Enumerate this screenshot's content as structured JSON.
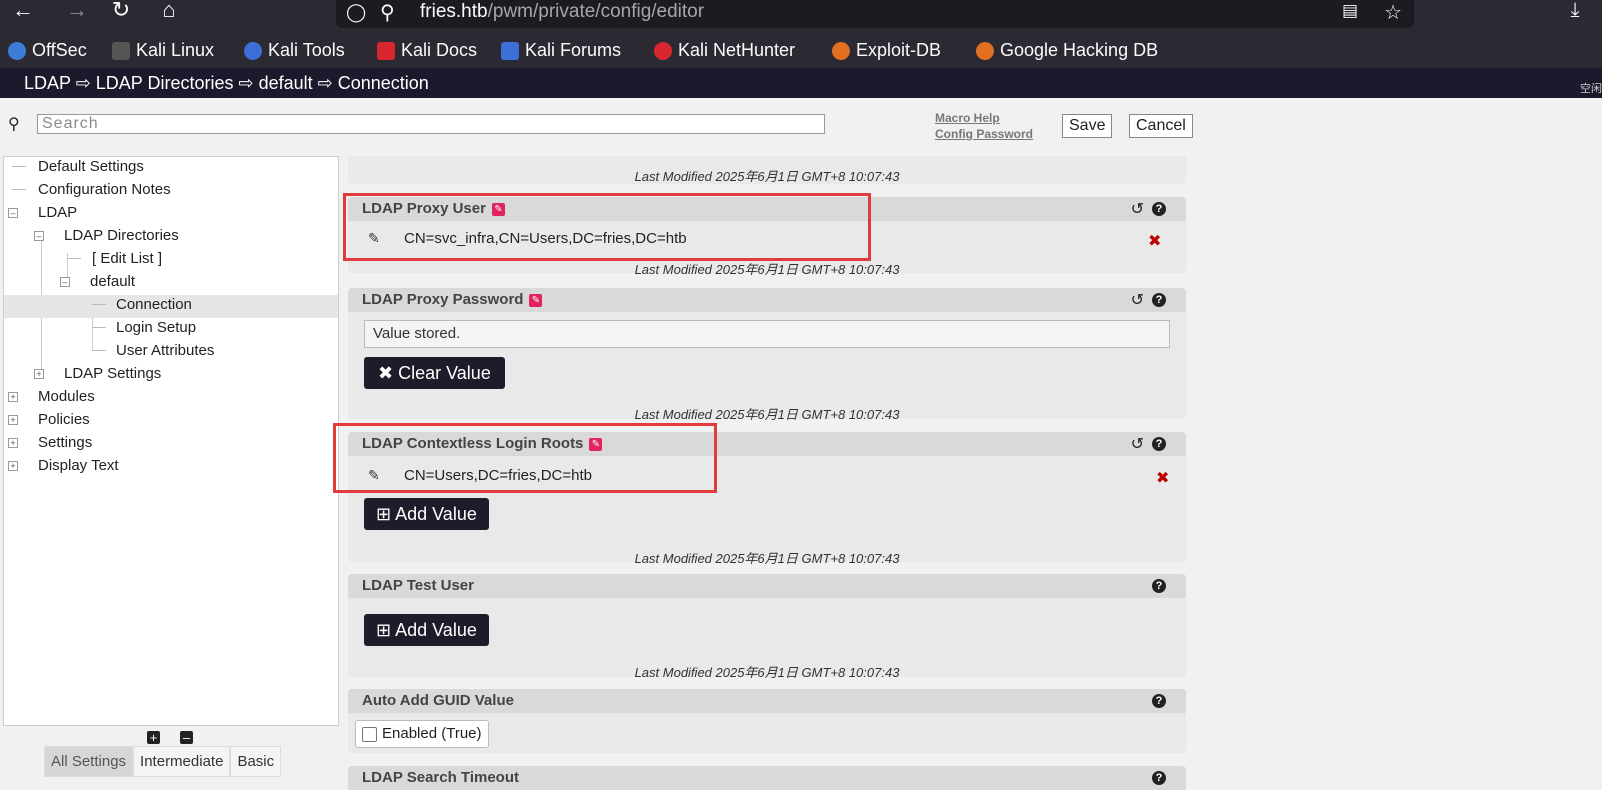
{
  "browser": {
    "url_host": "fries.htb",
    "url_path": "/pwm/private/config/editor"
  },
  "bookmarks": [
    {
      "label": "OffSec",
      "color": "#3d7bd8"
    },
    {
      "label": "Kali Linux",
      "color": "#2b2a33"
    },
    {
      "label": "Kali Tools",
      "color": "#3d6fd8"
    },
    {
      "label": "Kali Docs",
      "color": "#d8262e"
    },
    {
      "label": "Kali Forums",
      "color": "#3d6fd8"
    },
    {
      "label": "Kali NetHunter",
      "color": "#d8262e"
    },
    {
      "label": "Exploit-DB",
      "color": "#e07020"
    },
    {
      "label": "Google Hacking DB",
      "color": "#e07020"
    }
  ],
  "breadcrumb": "LDAP ⇨ LDAP Directories ⇨ default ⇨ Connection",
  "corner_text": "空闲",
  "toolbar": {
    "search_placeholder": "Search",
    "macro_help": "Macro Help",
    "config_password": "Config Password",
    "save": "Save",
    "cancel": "Cancel"
  },
  "tree": {
    "items": [
      {
        "label": "Default Settings"
      },
      {
        "label": "Configuration Notes"
      },
      {
        "label": "LDAP"
      },
      {
        "label": "LDAP Directories"
      },
      {
        "label": "[ Edit List ]"
      },
      {
        "label": "default"
      },
      {
        "label": "Connection"
      },
      {
        "label": "Login Setup"
      },
      {
        "label": "User Attributes"
      },
      {
        "label": "LDAP Settings"
      },
      {
        "label": "Modules"
      },
      {
        "label": "Policies"
      },
      {
        "label": "Settings"
      },
      {
        "label": "Display Text"
      }
    ],
    "level_tabs": [
      "All Settings",
      "Intermediate",
      "Basic"
    ]
  },
  "settings": {
    "last_modified": "Last Modified 2025年6月1日 GMT+8 10:07:43",
    "proxy_user": {
      "title": "LDAP Proxy User",
      "value": "CN=svc_infra,CN=Users,DC=fries,DC=htb"
    },
    "proxy_password": {
      "title": "LDAP Proxy Password",
      "stored": "Value stored.",
      "clear_button": "Clear Value"
    },
    "contextless_roots": {
      "title": "LDAP Contextless Login Roots",
      "value": "CN=Users,DC=fries,DC=htb",
      "add_button": "Add Value"
    },
    "test_user": {
      "title": "LDAP Test User",
      "add_button": "Add Value"
    },
    "guid": {
      "title": "Auto Add GUID Value",
      "checkbox_label": "Enabled (True)"
    },
    "search_timeout": {
      "title": "LDAP Search Timeout"
    }
  }
}
